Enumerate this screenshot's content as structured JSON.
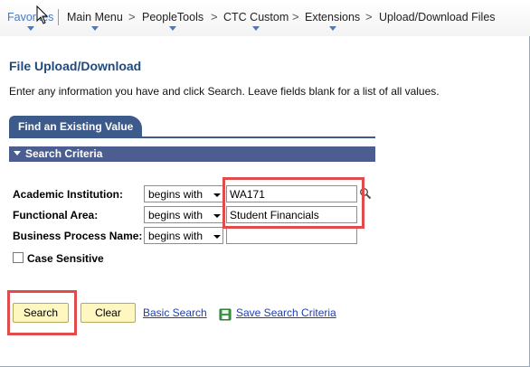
{
  "breadcrumb": {
    "items": [
      "Favorites",
      "Main Menu",
      "PeopleTools",
      "CTC Custom",
      "Extensions",
      "Upload/Download Files"
    ],
    "separator": ">"
  },
  "page": {
    "title": "File Upload/Download",
    "instructions": "Enter any information you have and click Search. Leave fields blank for a list of all values."
  },
  "tab": {
    "label": "Find an Existing Value"
  },
  "section": {
    "label": "Search Criteria"
  },
  "fields": [
    {
      "label": "Academic Institution:",
      "operator": "begins with",
      "value": "WA171"
    },
    {
      "label": "Functional Area:",
      "operator": "begins with",
      "value": "Student Financials"
    },
    {
      "label": "Business Process Name:",
      "operator": "begins with",
      "value": ""
    }
  ],
  "case_sensitive": {
    "label": "Case Sensitive",
    "checked": false
  },
  "actions": {
    "search": "Search",
    "clear": "Clear",
    "basic_search": "Basic Search",
    "save_search": "Save Search Criteria"
  },
  "colors": {
    "title": "#1e4a7f",
    "tab": "#3c5a8a",
    "section_bar": "#4b5e8f",
    "button": "#fff7c0",
    "link": "#1f3fb0",
    "highlight": "#e04b4b"
  }
}
